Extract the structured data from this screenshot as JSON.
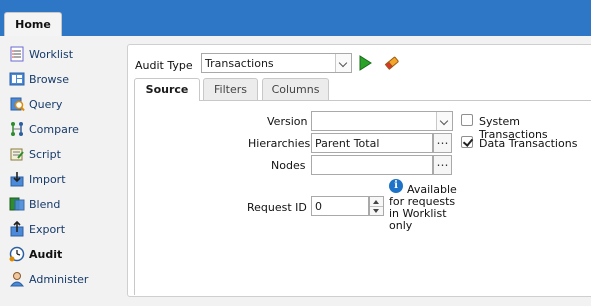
{
  "header": {
    "home_tab": "Home"
  },
  "sidebar": {
    "items": [
      {
        "label": "Worklist",
        "icon": "worklist-icon"
      },
      {
        "label": "Browse",
        "icon": "browse-icon"
      },
      {
        "label": "Query",
        "icon": "query-icon"
      },
      {
        "label": "Compare",
        "icon": "compare-icon"
      },
      {
        "label": "Script",
        "icon": "script-icon"
      },
      {
        "label": "Import",
        "icon": "import-icon"
      },
      {
        "label": "Blend",
        "icon": "blend-icon"
      },
      {
        "label": "Export",
        "icon": "export-icon"
      },
      {
        "label": "Audit",
        "icon": "audit-icon",
        "active": true
      },
      {
        "label": "Administer",
        "icon": "administer-icon"
      }
    ]
  },
  "audit": {
    "type_label": "Audit Type",
    "type_value": "Transactions"
  },
  "tabs": [
    {
      "label": "Source",
      "active": true
    },
    {
      "label": "Filters"
    },
    {
      "label": "Columns"
    }
  ],
  "form": {
    "version_label": "Version",
    "version_value": "",
    "hierarchies_label": "Hierarchies",
    "hierarchies_value": "Parent Total",
    "nodes_label": "Nodes",
    "nodes_value": "",
    "request_id_label": "Request ID",
    "request_id_value": "0",
    "info_text": "Available for requests in Worklist only"
  },
  "options": {
    "system_transactions_label": "System Transactions",
    "system_transactions_checked": false,
    "data_transactions_label": "Data Transactions",
    "data_transactions_checked": true
  },
  "colors": {
    "topbar": "#2e77c6",
    "run_green": "#2aa22a"
  }
}
